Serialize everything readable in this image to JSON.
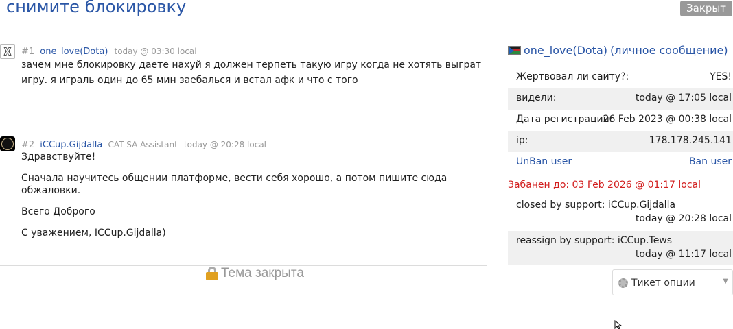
{
  "header": {
    "title": "снимите блокировку",
    "status": "Закрыт"
  },
  "posts": [
    {
      "num": "#1",
      "author": "one_love(Dota)",
      "role": "",
      "time": "today @ 03:30 local",
      "avatar_icon": "dota-logo-icon",
      "paragraphs": [
        "зачем мне блокировку даете нахуй я должен терпеть такую игру когда не хотять выграт игру. я играль один до 65 мин заебалься и встал афк и что с того"
      ]
    },
    {
      "num": "#2",
      "author": "iCCup.Gijdalla",
      "role": "CAT SA Assistant",
      "time": "today @ 20:28 local",
      "avatar_icon": "dark-orb-avatar",
      "paragraphs": [
        "Здравствуйте!",
        "Сначала научитесь общении платформе, вести себя хорошо, а потом пишите сюда обжаловки.",
        "Всего Доброго",
        "С уважением, ICCup.Gijdalla)"
      ]
    }
  ],
  "topic_closed": {
    "label": "Тема закрыта",
    "icon": "lock-icon"
  },
  "sidebar": {
    "user_name": "one_love(Dota)",
    "pm_link": "(личное сообщение)",
    "flag_icon": "flag-icon",
    "donated_label": "Жертвовал ли сайту?:",
    "donated_value": "YES!",
    "seen_label": "видели:",
    "seen_value": "today @ 17:05 local",
    "reg_label": "Дата регистрации:",
    "reg_value": "26 Feb 2023 @ 00:38 local",
    "ip_label": "ip:",
    "ip_value": "178.178.245.141",
    "unban_label": "UnBan user",
    "ban_label": "Ban user",
    "ban_until": "Забанен до: 03 Feb 2026 @ 01:17 local",
    "logs": [
      {
        "action": "closed by support: iCCup.Gijdalla",
        "time": "today @ 20:28 local"
      },
      {
        "action": "reassign by support: iCCup.Tews",
        "time": "today @ 11:17 local"
      }
    ],
    "ticket_options": "Тикет опции"
  },
  "colors": {
    "link": "#2a56a6",
    "ban": "#d21e1e",
    "muted": "#999999",
    "shaded_row": "#f0f0f0"
  }
}
